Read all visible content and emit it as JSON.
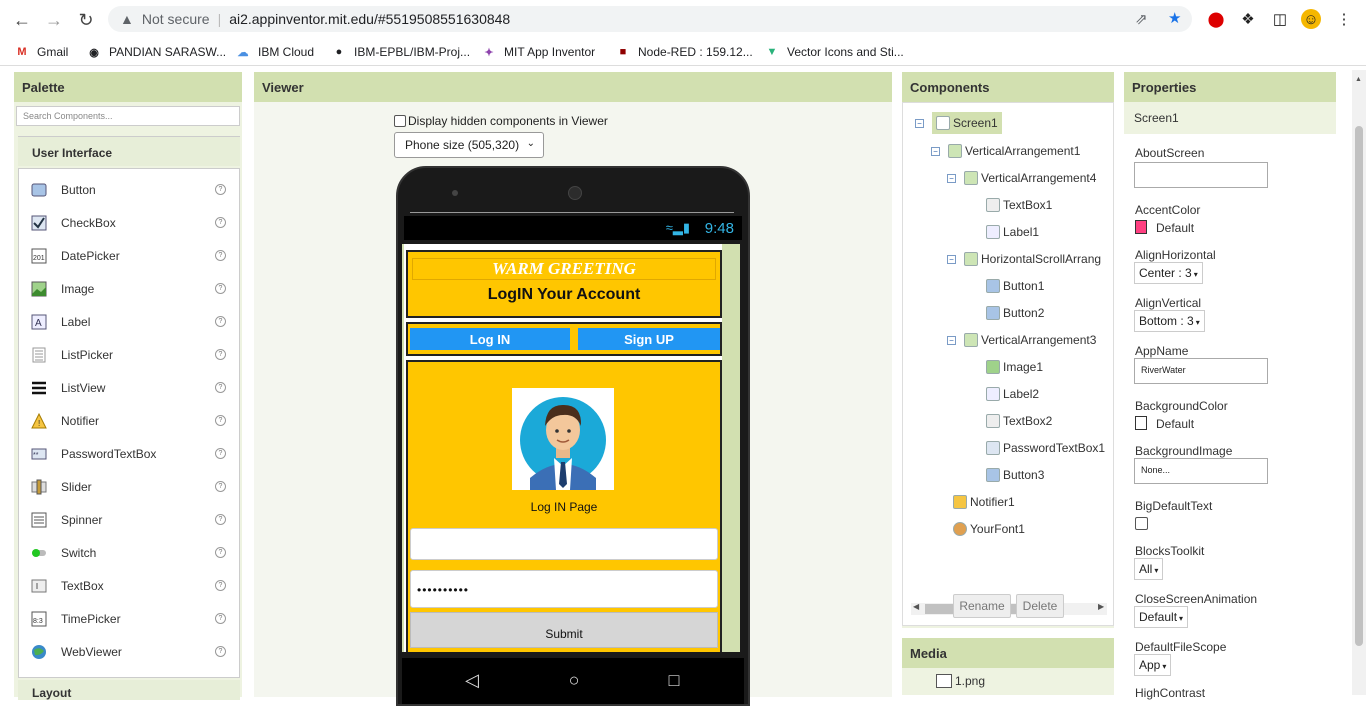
{
  "browser": {
    "security_label": "Not secure",
    "url": "ai2.appinventor.mit.edu/#5519508551630848",
    "bookmarks": [
      "Gmail",
      "PANDIAN SARASW...",
      "IBM Cloud",
      "IBM-EPBL/IBM-Proj...",
      "MIT App Inventor",
      "Node-RED : 159.12...",
      "Vector Icons and Sti..."
    ]
  },
  "palette": {
    "title": "Palette",
    "search_placeholder": "Search Components...",
    "section": "User Interface",
    "items": [
      "Button",
      "CheckBox",
      "DatePicker",
      "Image",
      "Label",
      "ListPicker",
      "ListView",
      "Notifier",
      "PasswordTextBox",
      "Slider",
      "Spinner",
      "Switch",
      "TextBox",
      "TimePicker",
      "WebViewer"
    ],
    "help": "?",
    "next_section": "Layout"
  },
  "viewer": {
    "title": "Viewer",
    "hidden_checkbox_label": "Display hidden components in Viewer",
    "size_select": "Phone size (505,320)",
    "status_time": "9:48",
    "app": {
      "warm_greeting": "WARM GREETING",
      "login_title": "LogIN Your Account",
      "login_button": "Log IN",
      "signup_button": "Sign UP",
      "page_caption": "Log IN Page",
      "password_value": "••••••••••",
      "submit_button": "Submit"
    }
  },
  "components": {
    "title": "Components",
    "tree": [
      "Screen1",
      "VerticalArrangement1",
      "VerticalArrangement4",
      "TextBox1",
      "Label1",
      "HorizontalScrollArrang",
      "Button1",
      "Button2",
      "VerticalArrangement3",
      "Image1",
      "Label2",
      "TextBox2",
      "PasswordTextBox1",
      "Button3",
      "Notifier1",
      "YourFont1"
    ],
    "rename": "Rename",
    "delete": "Delete"
  },
  "media": {
    "title": "Media",
    "file": "1.png"
  },
  "properties": {
    "title": "Properties",
    "screen": "Screen1",
    "about_screen": "AboutScreen",
    "accent_color": "AccentColor",
    "accent_value": "Default",
    "align_horizontal": "AlignHorizontal",
    "align_horizontal_value": "Center : 3",
    "align_vertical": "AlignVertical",
    "align_vertical_value": "Bottom : 3",
    "app_name": "AppName",
    "app_name_value": "RiverWater",
    "background_color": "BackgroundColor",
    "background_color_value": "Default",
    "background_image": "BackgroundImage",
    "background_image_value": "None...",
    "big_default_text": "BigDefaultText",
    "blocks_toolkit": "BlocksToolkit",
    "blocks_toolkit_value": "All",
    "close_anim": "CloseScreenAnimation",
    "close_anim_value": "Default",
    "default_file_scope": "DefaultFileScope",
    "default_file_scope_value": "App",
    "high_contrast": "HighContrast"
  },
  "colors": {
    "panel_head": "#d2e0b0",
    "app_yellow": "#ffc600",
    "app_blue": "#2196f3",
    "accent_swatch": "#ff4081"
  }
}
